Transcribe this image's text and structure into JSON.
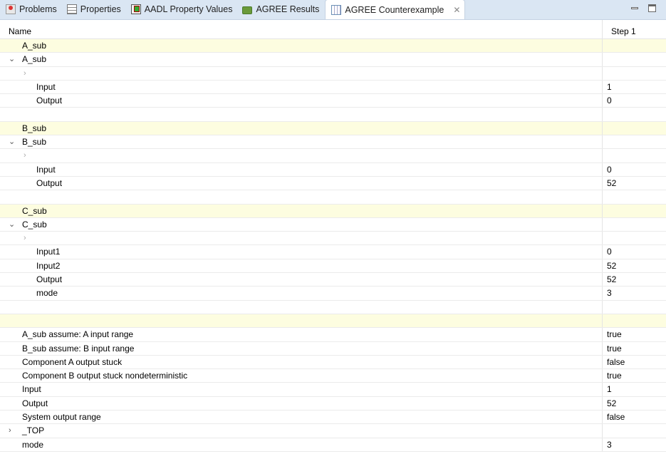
{
  "tabs": [
    {
      "label": "Problems",
      "icon": "problems-icon"
    },
    {
      "label": "Properties",
      "icon": "properties-icon"
    },
    {
      "label": "AADL Property Values",
      "icon": "aadl-icon"
    },
    {
      "label": "AGREE Results",
      "icon": "results-icon"
    },
    {
      "label": "AGREE Counterexample",
      "icon": "table-icon",
      "active": true
    }
  ],
  "columns": {
    "name": "Name",
    "step": "Step 1"
  },
  "rows": [
    {
      "name": "A_sub",
      "value": "",
      "style": "yellow"
    },
    {
      "name": "A_sub",
      "value": "",
      "twisty": "expanded"
    },
    {
      "name": "",
      "value": "",
      "twisty": "collapsed-child"
    },
    {
      "name": "Input",
      "value": "1",
      "level": 2
    },
    {
      "name": "Output",
      "value": "0",
      "level": 2
    },
    {
      "name": "",
      "value": ""
    },
    {
      "name": "B_sub",
      "value": "",
      "style": "yellow"
    },
    {
      "name": "B_sub",
      "value": "",
      "twisty": "expanded"
    },
    {
      "name": "",
      "value": "",
      "twisty": "collapsed-child"
    },
    {
      "name": "Input",
      "value": "0",
      "level": 2
    },
    {
      "name": "Output",
      "value": "52",
      "level": 2
    },
    {
      "name": "",
      "value": ""
    },
    {
      "name": "C_sub",
      "value": "",
      "style": "yellow"
    },
    {
      "name": "C_sub",
      "value": "",
      "twisty": "expanded"
    },
    {
      "name": "",
      "value": "",
      "twisty": "collapsed-child"
    },
    {
      "name": "Input1",
      "value": "0",
      "level": 2
    },
    {
      "name": "Input2",
      "value": "52",
      "level": 2
    },
    {
      "name": "Output",
      "value": "52",
      "level": 2
    },
    {
      "name": "mode",
      "value": "3",
      "level": 2
    },
    {
      "name": "",
      "value": ""
    },
    {
      "name": "",
      "value": "",
      "style": "yellow"
    },
    {
      "name": "A_sub assume: A input range",
      "value": "true"
    },
    {
      "name": "B_sub assume: B input range",
      "value": "true"
    },
    {
      "name": "Component A output stuck",
      "value": "false"
    },
    {
      "name": "Component B output stuck nondeterministic",
      "value": "true"
    },
    {
      "name": "Input",
      "value": "1"
    },
    {
      "name": "Output",
      "value": "52"
    },
    {
      "name": "System output range",
      "value": "false"
    },
    {
      "name": "_TOP",
      "value": "",
      "twisty": "collapsed"
    },
    {
      "name": "mode",
      "value": "3"
    }
  ]
}
